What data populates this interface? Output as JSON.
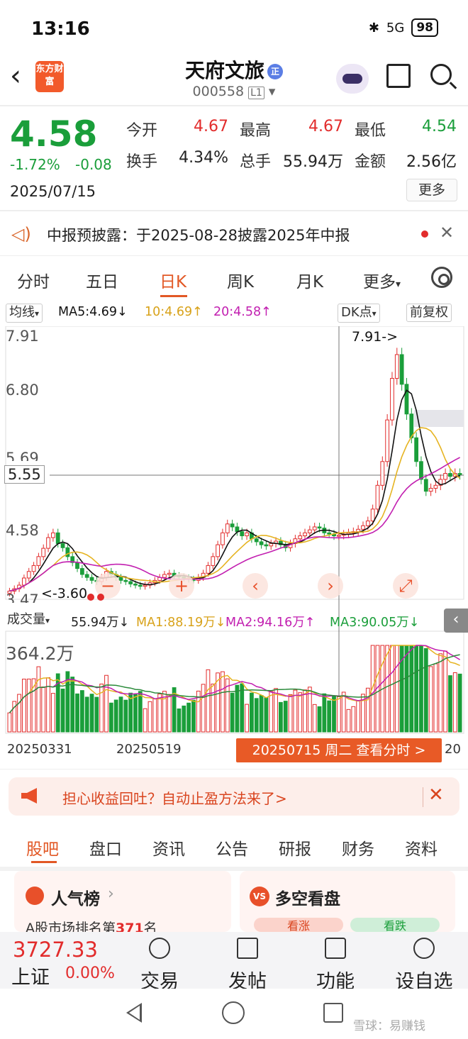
{
  "status": {
    "time": "13:16",
    "network": "5G",
    "battery": "98"
  },
  "header": {
    "logo": "东方财富",
    "stock_name": "天府文旅",
    "tag": "正",
    "code": "000558",
    "level": "L1"
  },
  "quote": {
    "price": "4.58",
    "change_pct": "-1.72%",
    "change": "-0.08",
    "date": "2025/07/15",
    "open_label": "今开",
    "open": "4.67",
    "high_label": "最高",
    "high": "4.67",
    "low_label": "最低",
    "low": "4.54",
    "turnover_label": "换手",
    "turnover": "4.34%",
    "volume_label": "总手",
    "volume": "55.94万",
    "amount_label": "金额",
    "amount": "2.56亿",
    "more": "更多"
  },
  "notice": {
    "text": "中报预披露：于2025-08-28披露2025年中报"
  },
  "period_tabs": [
    "分时",
    "五日",
    "日K",
    "周K",
    "月K",
    "更多"
  ],
  "ma_legend": {
    "selector": "均线",
    "ma5": "MA5:4.69↓",
    "ma10": "10:4.69↑",
    "ma20": "20:4.58↑",
    "dk": "DK点",
    "adjust": "前复权"
  },
  "price_axis": {
    "top": "7.91",
    "mid": "6.80",
    "lower": "5.69",
    "cross": "5.55",
    "low": "4.58",
    "bottom": "3.47"
  },
  "chart_marks": {
    "max": "7.91->",
    "min": "<-3.60"
  },
  "volume_legend": {
    "selector": "成交量",
    "vol": "55.94万↓",
    "ma1": "MA1:88.19万↓",
    "ma2": "MA2:94.16万↑",
    "ma3": "MA3:90.05万↓",
    "max": "364.2万"
  },
  "x_axis": {
    "d1": "20250331",
    "d2": "20250519",
    "end": "20"
  },
  "date_tip": "20250715 周二 查看分时 >",
  "ad": {
    "text": "担心收益回吐？自动止盈方法来了>"
  },
  "bottom_tabs": [
    "股吧",
    "盘口",
    "资讯",
    "公告",
    "研报",
    "财务",
    "资料"
  ],
  "cards": {
    "popular": {
      "title": "人气榜",
      "sub_prefix": "A股市场排名第",
      "rank": "371",
      "sub_suffix": "名"
    },
    "bullbear": {
      "badge": "VS",
      "title": "多空看盘",
      "bull": "看涨",
      "bear": "看跌"
    }
  },
  "footer": {
    "index_value": "3727.33",
    "index_name": "上证",
    "index_change": "0.00%",
    "nav": [
      "交易",
      "发帖",
      "功能",
      "设自选"
    ]
  },
  "watermark": "雪球：易赚钱",
  "colors": {
    "up": "#e22c2c",
    "down": "#1a9e3a",
    "accent": "#e25825",
    "ma5": "#111111",
    "ma10": "#e6b422",
    "ma20": "#c21fb0"
  },
  "chart_data": {
    "type": "candlestick",
    "y_range": [
      3.47,
      7.91
    ],
    "close": [
      3.62,
      3.66,
      3.72,
      3.84,
      3.95,
      4.05,
      4.2,
      4.34,
      4.52,
      4.6,
      4.42,
      4.35,
      4.2,
      4.1,
      4.0,
      3.9,
      3.85,
      3.8,
      3.78,
      3.85,
      3.95,
      3.9,
      3.85,
      3.8,
      3.78,
      3.74,
      3.72,
      3.7,
      3.72,
      3.76,
      3.8,
      3.85,
      3.9,
      3.92,
      3.88,
      3.86,
      3.84,
      3.82,
      3.8,
      3.85,
      3.92,
      4.05,
      4.2,
      4.4,
      4.6,
      4.75,
      4.7,
      4.62,
      4.55,
      4.6,
      4.5,
      4.45,
      4.4,
      4.38,
      4.42,
      4.46,
      4.4,
      4.35,
      4.42,
      4.5,
      4.55,
      4.6,
      4.65,
      4.7,
      4.68,
      4.6,
      4.58,
      4.55,
      4.56,
      4.58,
      4.6,
      4.62,
      4.66,
      4.72,
      4.8,
      5.0,
      5.4,
      5.8,
      6.5,
      7.2,
      7.6,
      7.1,
      6.6,
      6.2,
      5.8,
      5.5,
      5.3,
      5.35,
      5.4,
      5.5,
      5.6,
      5.55,
      5.6,
      5.58
    ]
  }
}
